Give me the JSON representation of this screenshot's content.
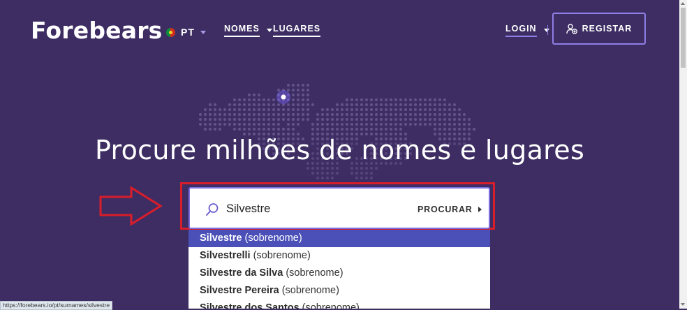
{
  "header": {
    "logo": "Forebears",
    "language": "PT",
    "nav": [
      {
        "label": "NOMES"
      },
      {
        "label": "LUGARES"
      }
    ],
    "login_label": "LOGIN",
    "register_label": "REGISTAR"
  },
  "hero": {
    "headline": "Procure milhões de nomes e lugares"
  },
  "search": {
    "value": "Silvestre",
    "button_label": "PROCURAR",
    "icon": "search-icon"
  },
  "suggestions": [
    {
      "bold": "Silvestre",
      "rest": " (sobrenome)"
    },
    {
      "bold": "Silvestrelli",
      "rest": " (sobrenome)"
    },
    {
      "bold": "Silvestre da Silva",
      "rest": " (sobrenome)"
    },
    {
      "bold": "Silvestre Pereira",
      "rest": " (sobrenome)"
    },
    {
      "bold": "Silvestre dos Santos",
      "rest": " (sobrenome)"
    }
  ],
  "status_url": "https://forebears.io/pt/surnames/silvestre",
  "colors": {
    "background": "#3d2d63",
    "accent": "#8f7ee4",
    "highlight": "#4a50b7",
    "annotation_red": "#d91d2a"
  }
}
